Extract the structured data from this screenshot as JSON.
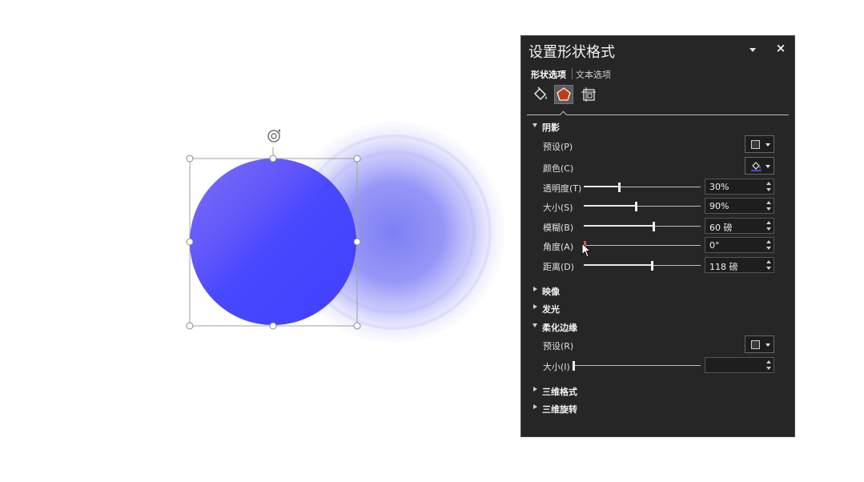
{
  "panel": {
    "title": "设置形状格式",
    "tabs": {
      "shape": "形状选项",
      "text": "文本选项"
    },
    "icons": [
      "fill-line-icon",
      "effects-icon",
      "size-properties-icon"
    ],
    "sections": {
      "shadow": {
        "title": "阴影",
        "preset_label": "预设(P)",
        "color_label": "颜色(C)",
        "transparency_label": "透明度(T)",
        "transparency_value": "30%",
        "transparency_level": 0.3,
        "size_label": "大小(S)",
        "size_value": "90%",
        "size_level": 0.45,
        "blur_label": "模糊(B)",
        "blur_value": "60 磅",
        "blur_level": 0.6,
        "angle_label": "角度(A)",
        "angle_value": "0°",
        "angle_level": 0.0,
        "distance_label": "距离(D)",
        "distance_value": "118 磅",
        "distance_level": 0.59
      },
      "reflection": {
        "title": "映像"
      },
      "glow": {
        "title": "发光"
      },
      "soft_edges": {
        "title": "柔化边缘",
        "preset_label": "预设(R)",
        "size_label": "大小(I)",
        "size_value": "",
        "size_level": 0.0
      },
      "three_d_format": {
        "title": "三维格式"
      },
      "three_d_rotation": {
        "title": "三维旋转"
      }
    }
  },
  "colors": {
    "circle_fill": "#4646ff",
    "circle_highlight": "#7a6cf7",
    "shadow": "#7c7cf5",
    "panel_bg": "#262626",
    "effects_icon": "#c0391b"
  }
}
